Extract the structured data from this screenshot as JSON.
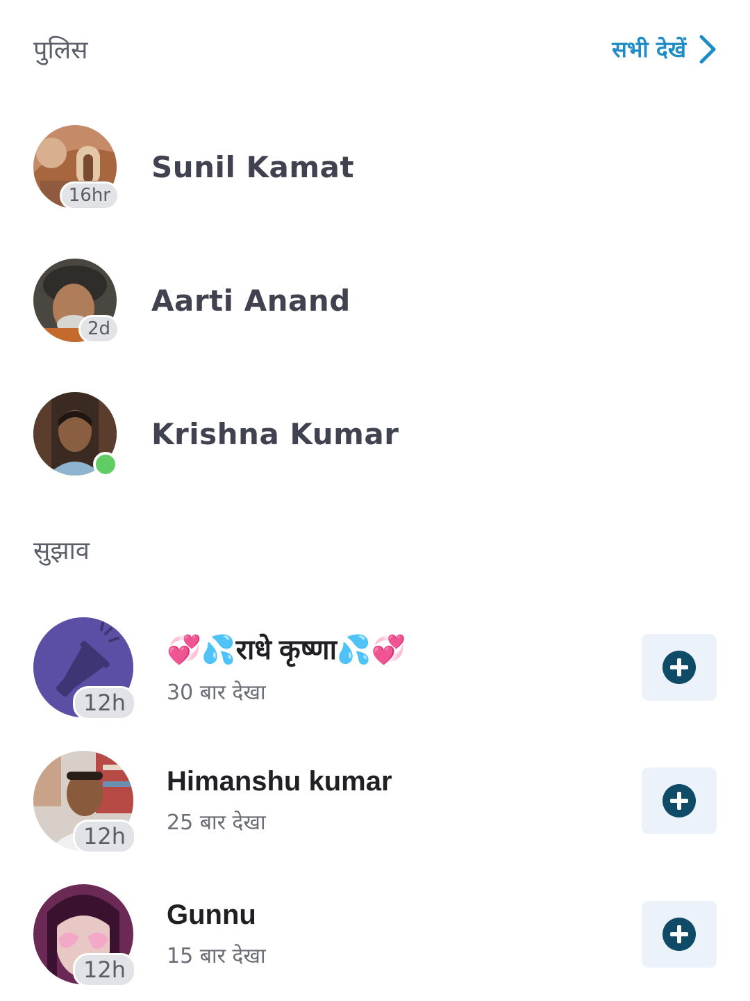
{
  "police_section": {
    "title": "पुलिस",
    "see_all_label": "सभी देखें",
    "see_all_icon": "chevron-right-icon",
    "people": [
      {
        "name": "Sunil Kamat",
        "time": "16hr",
        "avatar": "photo-avatar"
      },
      {
        "name": "Aarti Anand",
        "time": "2d",
        "avatar": "photo-avatar"
      },
      {
        "name": "Krishna Kumar",
        "time": "",
        "online": true,
        "avatar": "photo-avatar"
      }
    ]
  },
  "suggestions_section": {
    "title": "सुझाव",
    "items": [
      {
        "name": "💞💦राधे कृष्णा💦💞",
        "views": "30 बार देखा",
        "time": "12h",
        "avatar": "megaphone-icon"
      },
      {
        "name": "Himanshu kumar",
        "views": "25 बार देखा",
        "time": "12h",
        "avatar": "photo-avatar"
      },
      {
        "name": "Gunnu",
        "views": "15 बार देखा",
        "time": "12h",
        "avatar": "photo-avatar"
      }
    ],
    "add_button_icon": "plus-circle-icon"
  },
  "colors": {
    "accent_link": "#1e8cc7",
    "online_green": "#5fcd63",
    "add_button_bg": "#ebf2fa",
    "add_icon": "#0f4a66",
    "megaphone_avatar_bg": "#5a4fa5"
  }
}
